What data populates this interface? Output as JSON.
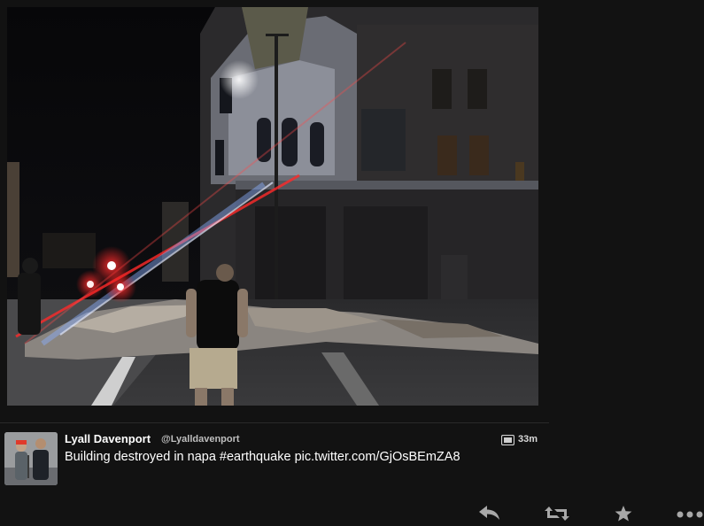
{
  "tweet": {
    "name": "Lyall Davenport",
    "handle": "@Lyalldavenport",
    "time": "33m",
    "text": "Building destroyed in napa #earthquake pic.twitter.com/GjOsBEmZA8"
  },
  "icons": {
    "media": "image-icon",
    "reply": "reply-icon",
    "retweet": "retweet-icon",
    "favorite": "star-icon",
    "more": "more-icon"
  },
  "colors": {
    "background": "#121212",
    "text": "#ffffff",
    "secondary_text": "#bfbfbf",
    "icon": "#a8a8a8"
  }
}
